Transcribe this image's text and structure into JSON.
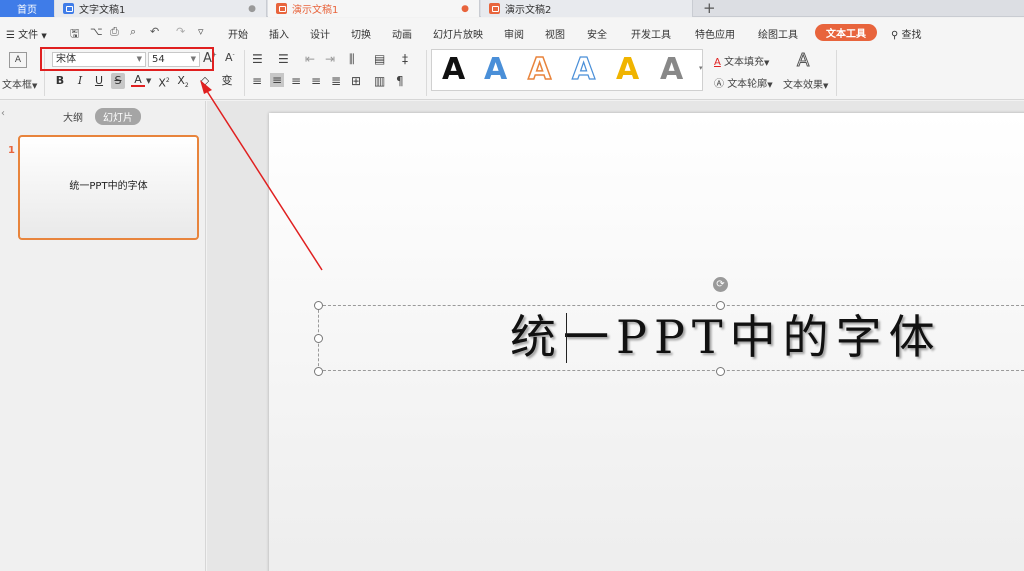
{
  "tabs": {
    "home": "首页",
    "doc1": "文字文稿1",
    "doc2": "演示文稿1",
    "doc3": "演示文稿2",
    "add": "+"
  },
  "menu": {
    "file": "文件",
    "items": [
      "开始",
      "插入",
      "设计",
      "切换",
      "动画",
      "幻灯片放映",
      "审阅",
      "视图",
      "安全",
      "开发工具",
      "特色应用",
      "绘图工具"
    ],
    "text_tools": "文本工具",
    "search": "查找"
  },
  "ribbon": {
    "textbox_label": "文本框",
    "font_name": "宋体",
    "font_size": "54",
    "text_fill": "文本填充",
    "text_outline": "文本轮廓",
    "text_effect": "文本效果",
    "wordart_glyph": "A",
    "colors": {
      "accent": "#e8643c",
      "highlight_box": "#e02020",
      "wordart_blue": "#4a8fd8",
      "wordart_orange": "#e8843c",
      "wordart_yellow": "#f0b400"
    }
  },
  "left_panel": {
    "outline_tab": "大纲",
    "slides_tab": "幻灯片",
    "slide_number": "1",
    "slide_thumb_text": "统一PPT中的字体"
  },
  "slide": {
    "title": "统一PPT中的字体"
  }
}
